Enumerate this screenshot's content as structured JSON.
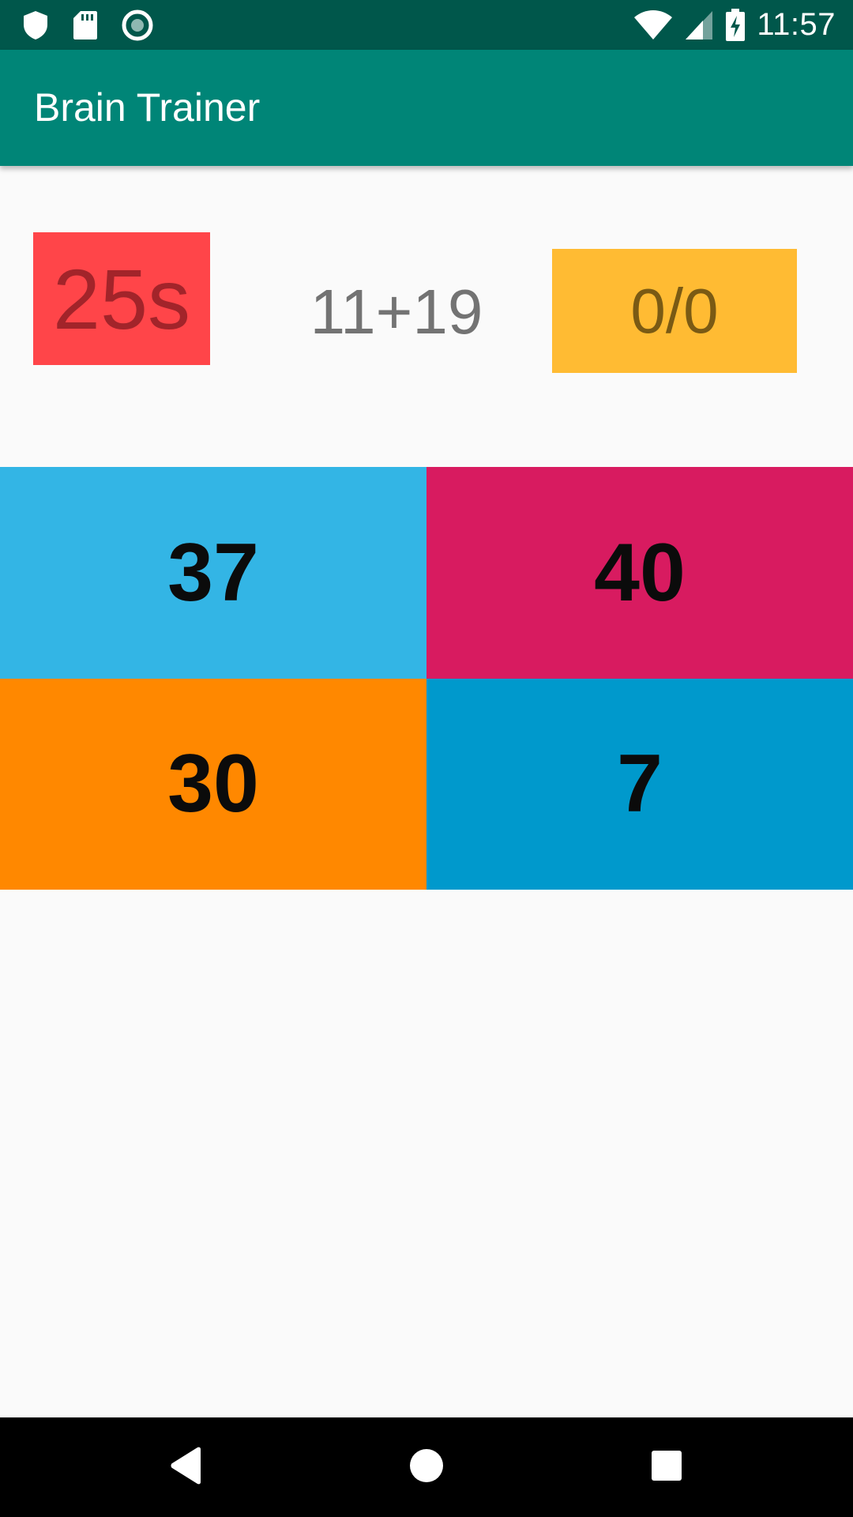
{
  "status_bar": {
    "time": "11:57",
    "left_icons": [
      "shield-icon",
      "sd-card-icon",
      "record-icon"
    ],
    "right_icons": [
      "wifi-icon",
      "signal-icon",
      "battery-charging-icon"
    ]
  },
  "app_bar": {
    "title": "Brain Trainer"
  },
  "game": {
    "timer": "25s",
    "question": "11+19",
    "score": "0/0"
  },
  "answers": [
    {
      "value": "37",
      "color": "#33b5e5"
    },
    {
      "value": "40",
      "color": "#d81b60"
    },
    {
      "value": "30",
      "color": "#ff8800"
    },
    {
      "value": "7",
      "color": "#0099cc"
    }
  ],
  "colors": {
    "status_bar": "#00574b",
    "app_bar": "#008577",
    "timer_bg": "#ff4549",
    "score_bg": "#ffbb33",
    "background": "#fafafa"
  },
  "nav_bar": {
    "icons": [
      "back-icon",
      "home-icon",
      "recents-icon"
    ]
  }
}
